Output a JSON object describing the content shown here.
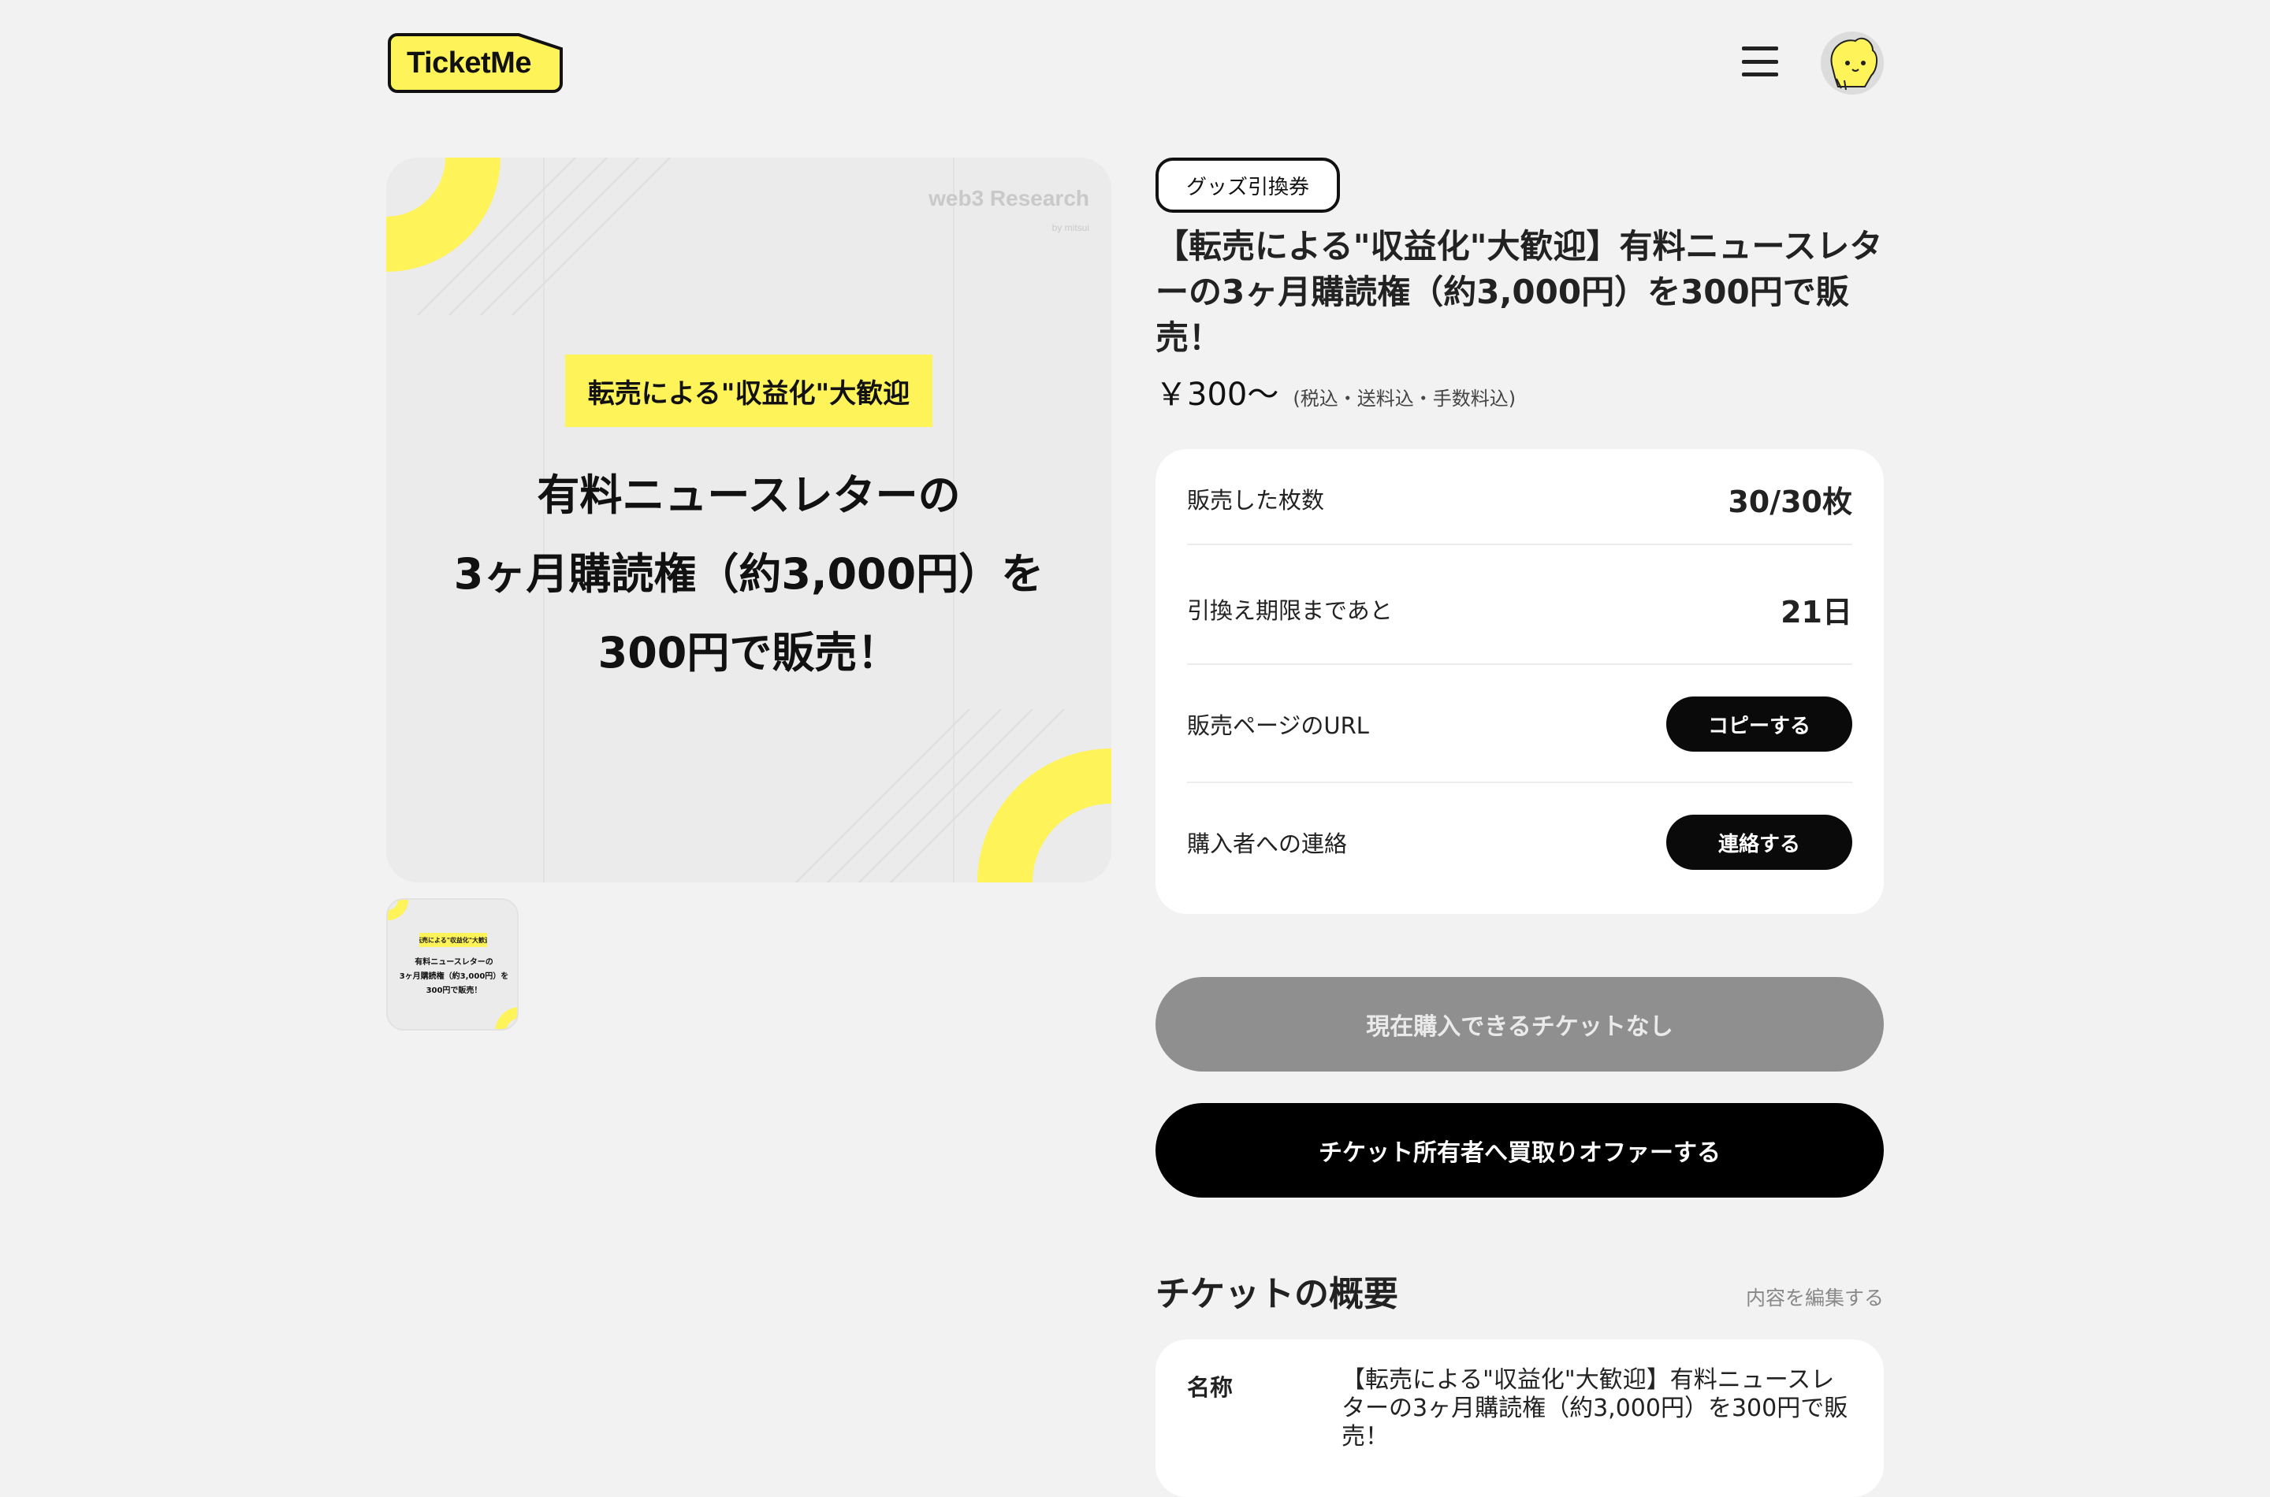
{
  "header": {
    "logo_text": "TicketMe",
    "logo_color": "#fff35a"
  },
  "image": {
    "brand": "web3 Research",
    "brand_sub": "by mitsui",
    "highlight": "転売による\"収益化\"大歓迎",
    "line1": "有料ニュースレターの",
    "line2": "3ヶ月購読権（約3,000円）を",
    "line3": "300円で販売！",
    "accent_color": "#fff35a"
  },
  "product": {
    "category": "グッズ引換券",
    "title": "【転売による\"収益化\"大歓迎】有料ニュースレターの3ヶ月購読権（約3,000円）を300円で販売！",
    "price": "￥300〜",
    "price_note": "(税込・送料込・手数料込)"
  },
  "info": {
    "sold_label": "販売した枚数",
    "sold_value": "30/30枚",
    "deadline_label": "引換え期限まであと",
    "deadline_value": "21日",
    "url_label": "販売ページのURL",
    "copy_button": "コピーする",
    "contact_label": "購入者への連絡",
    "contact_button": "連絡する"
  },
  "actions": {
    "no_tickets": "現在購入できるチケットなし",
    "offer": "チケット所有者へ買取りオファーする"
  },
  "overview": {
    "title": "チケットの概要",
    "edit_link": "内容を編集する",
    "name_label": "名称",
    "name_value": "【転売による\"収益化\"大歓迎】有料ニュースレターの3ヶ月購読権（約3,000円）を300円で販売！"
  }
}
